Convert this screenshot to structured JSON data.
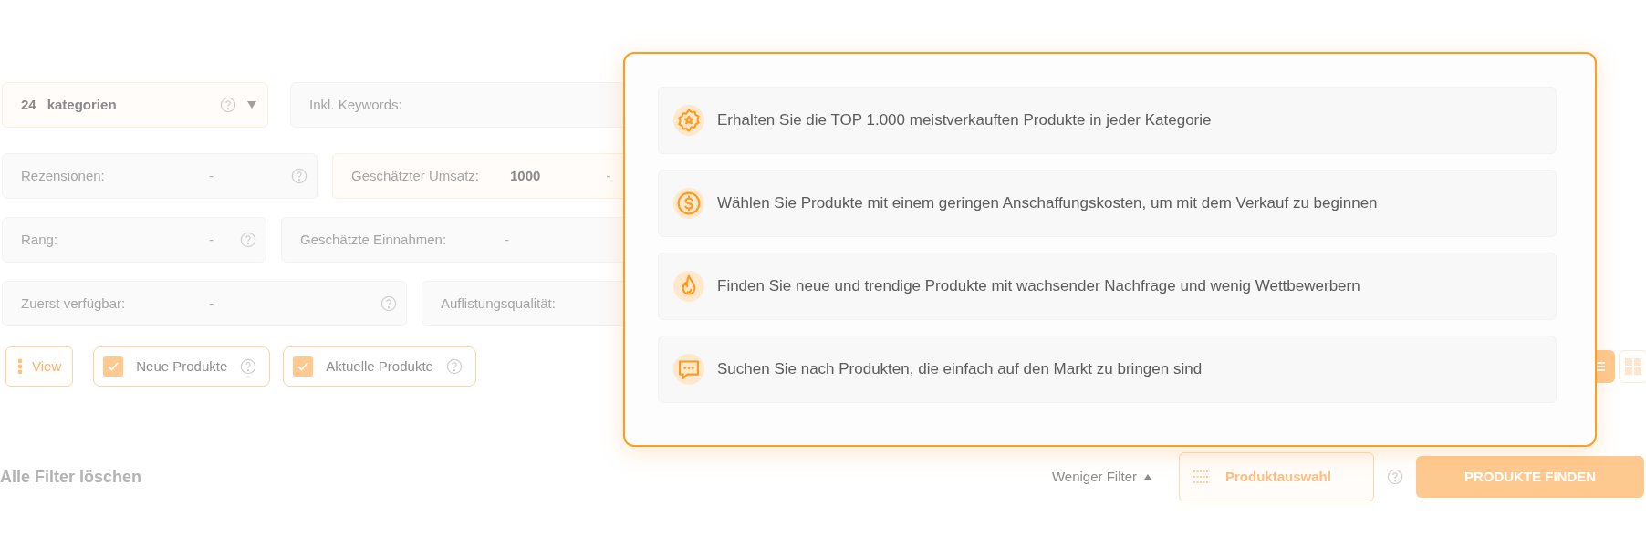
{
  "filters": {
    "category": {
      "count": "24",
      "label": "kategorien"
    },
    "keywords": {
      "label": "Inkl. Keywords:"
    },
    "rows": [
      [
        {
          "label": "Rezensionen:",
          "from": "-",
          "help": true,
          "highlighted": false
        },
        {
          "label": "Geschätzter Umsatz:",
          "from": "1000",
          "to": "-",
          "highlighted": true
        }
      ],
      [
        {
          "label": "Rang:",
          "from": "-",
          "help": true,
          "highlighted": false
        },
        {
          "label": "Geschätzte Einnahmen:",
          "from": "-",
          "highlighted": false
        }
      ],
      [
        {
          "label": "Zuerst verfügbar:",
          "from": "-",
          "help": true,
          "highlighted": false
        },
        {
          "label": "Auflistungsqualität:",
          "highlighted": false
        }
      ]
    ]
  },
  "view_button": {
    "label": "View"
  },
  "checkboxes": [
    {
      "label": "Neue Produkte",
      "checked": true
    },
    {
      "label": "Aktuelle Produkte",
      "checked": true
    }
  ],
  "view_toggle": [
    {
      "kind": "list",
      "selected": true
    },
    {
      "kind": "grid",
      "selected": false
    }
  ],
  "popup": {
    "items": [
      {
        "kind": "badge",
        "text": "Erhalten Sie die TOP 1.000 meistverkauften Produkte in jeder Kategorie"
      },
      {
        "kind": "dollar",
        "text": "Wählen Sie Produkte mit einem geringen Anschaffungskosten, um mit dem Verkauf zu beginnen"
      },
      {
        "kind": "flame",
        "text": "Finden Sie neue und trendige Produkte mit wachsender Nachfrage und wenig Wettbewerbern"
      },
      {
        "kind": "chat",
        "text": "Suchen Sie nach Produkten, die einfach auf den Markt zu bringen sind"
      }
    ]
  },
  "bottom": {
    "clear": "Alle Filter löschen",
    "less": "Weniger Filter",
    "selection": "Produktauswahl",
    "find": "PRODUKTE FINDEN"
  }
}
